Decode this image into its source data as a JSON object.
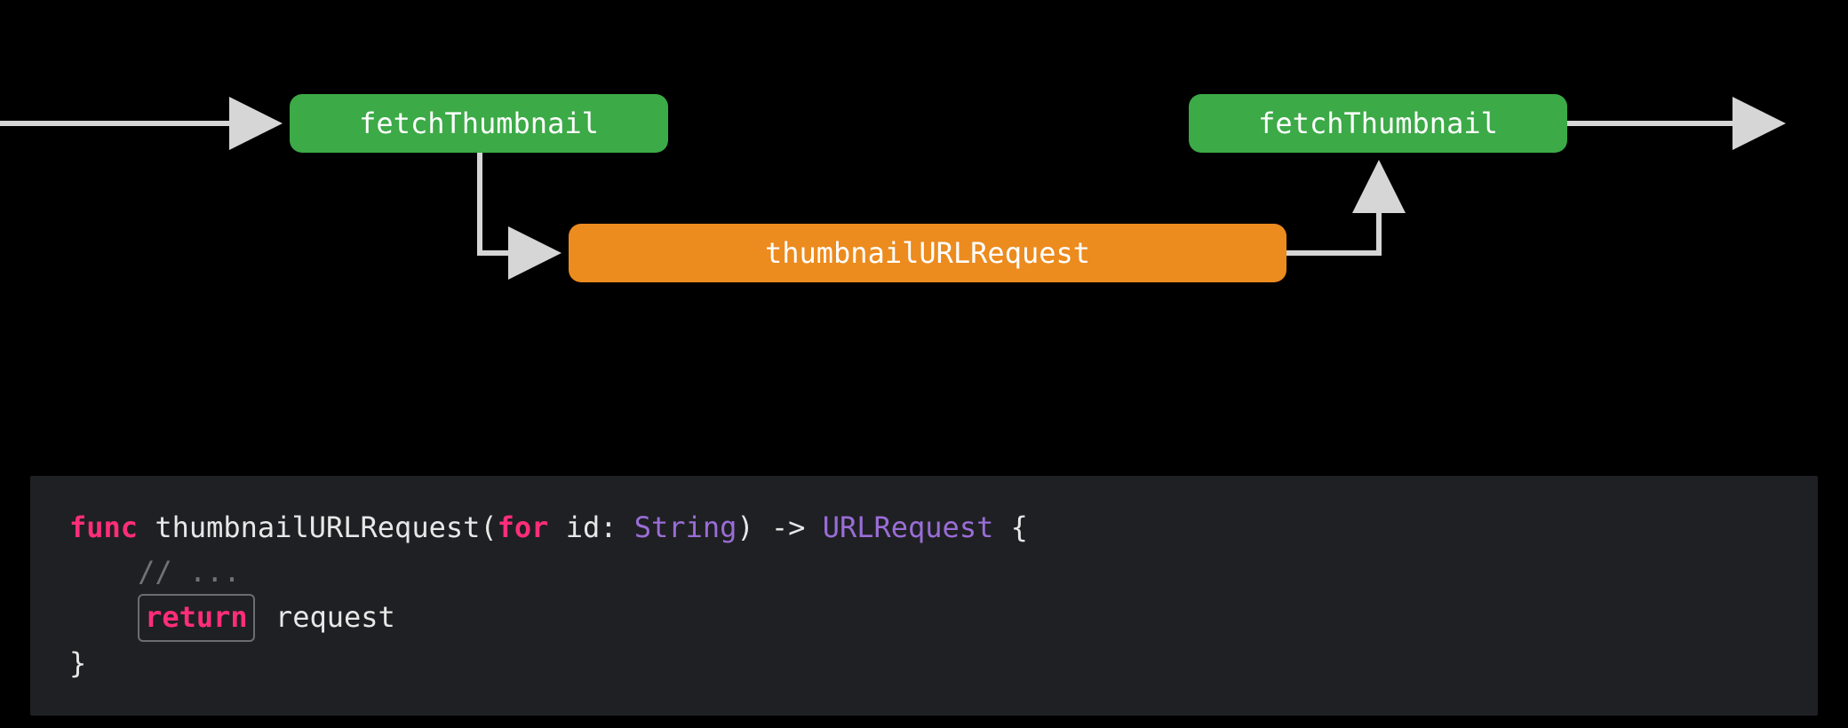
{
  "diagram": {
    "node_left": {
      "label": "fetchThumbnail"
    },
    "node_middle": {
      "label": "thumbnailURLRequest"
    },
    "node_right": {
      "label": "fetchThumbnail"
    }
  },
  "code": {
    "kw_func": "func",
    "func_name": " thumbnailURLRequest(",
    "kw_for": "for",
    "after_for": " id: ",
    "type_string": "String",
    "paren_arrow": ") -> ",
    "type_urlrequest": "URLRequest",
    "brace_open": " {",
    "indent1": "    ",
    "comment": "// ...",
    "kw_return": "return",
    "after_return": " request",
    "brace_close": "}"
  },
  "colors": {
    "green": "#3caa47",
    "orange": "#ec8b1e",
    "arrow": "#d6d6d6",
    "code_bg": "#1f2023",
    "pink": "#ff2d7a",
    "violet": "#9a6dd7"
  }
}
